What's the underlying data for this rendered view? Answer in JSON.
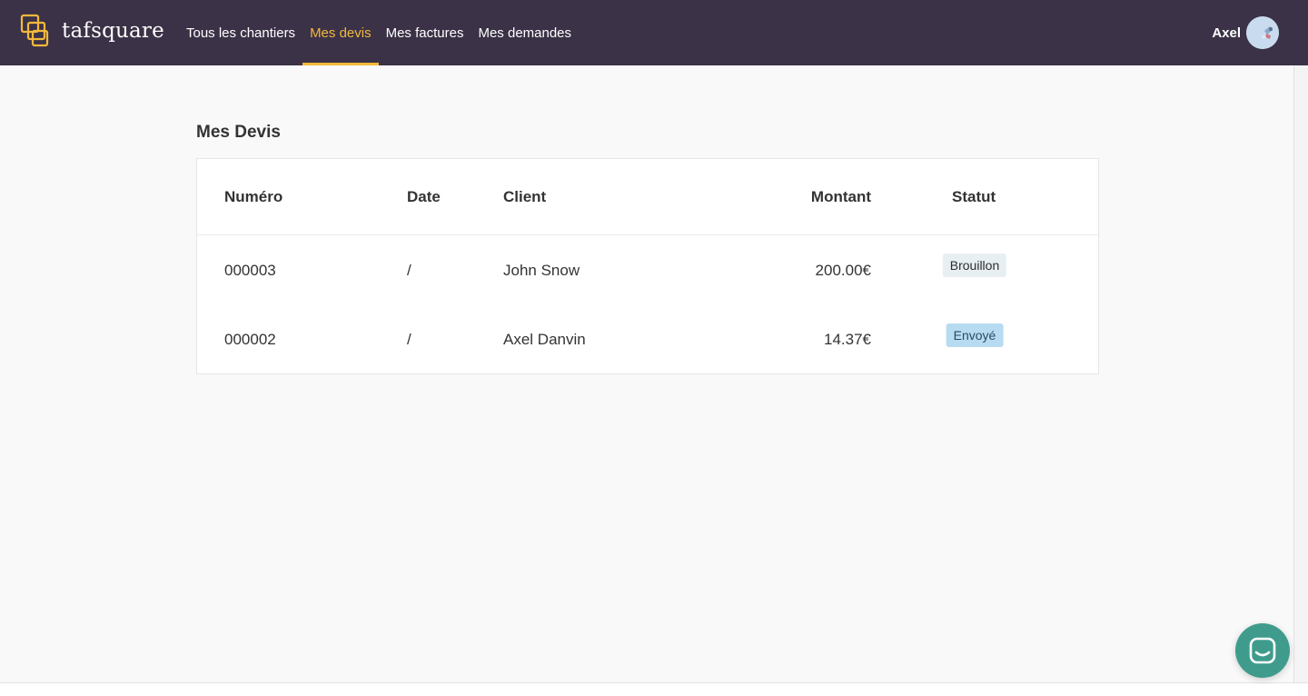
{
  "brand": {
    "name": "tafsquare",
    "logo_icon": "overlapping-squares-logo",
    "accent_color": "#f3b93a"
  },
  "nav": {
    "items": [
      {
        "label": "Tous les chantiers",
        "active": false
      },
      {
        "label": "Mes devis",
        "active": true
      },
      {
        "label": "Mes factures",
        "active": false
      },
      {
        "label": "Mes demandes",
        "active": false
      }
    ]
  },
  "user": {
    "name": "Axel",
    "avatar_icon": "user-avatar"
  },
  "page": {
    "title": "Mes Devis"
  },
  "table": {
    "headers": {
      "number": "Numéro",
      "date": "Date",
      "client": "Client",
      "amount": "Montant",
      "status": "Statut"
    },
    "rows": [
      {
        "number": "000003",
        "date": "/",
        "client": "John Snow",
        "amount": "200.00€",
        "status": "Brouillon",
        "status_color": "#e8eff2"
      },
      {
        "number": "000002",
        "date": "/",
        "client": "Axel Danvin",
        "amount": "14.37€",
        "status": "Envoyé",
        "status_color": "#b7dcf1"
      }
    ]
  },
  "chat": {
    "icon": "chat-bubble-icon",
    "color": "#3f9c8c"
  },
  "colors": {
    "navbar": "#3b3247",
    "background": "#f9f9f9"
  }
}
